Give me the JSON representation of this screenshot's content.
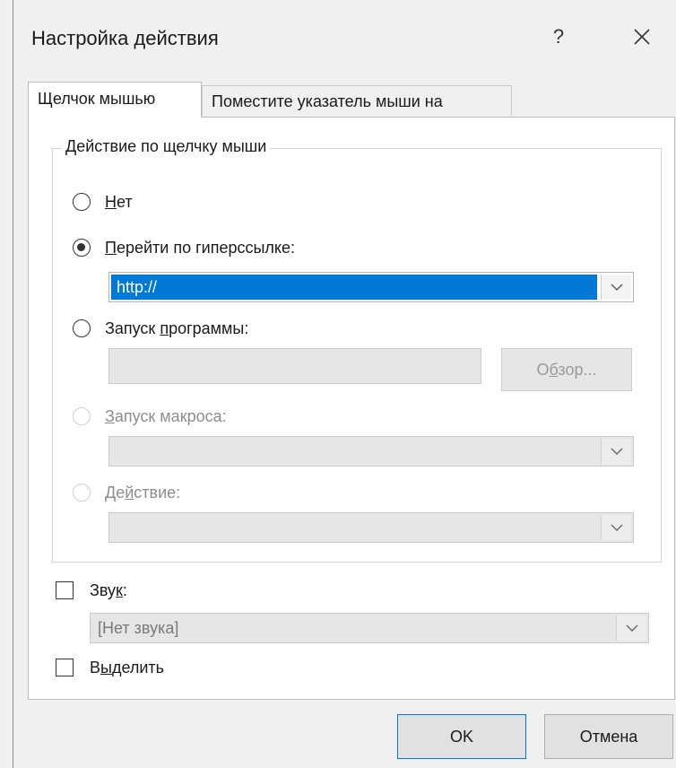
{
  "dialog": {
    "title": "Настройка действия",
    "help_label": "?"
  },
  "tabs": [
    {
      "label": "Щелчок мышью",
      "active": true
    },
    {
      "label": "Поместите указатель мыши на",
      "active": false
    }
  ],
  "group": {
    "legend": "Действие по щелчку мыши",
    "options": {
      "none": {
        "prefix": "",
        "mnemonic": "Н",
        "suffix": "ет",
        "checked": false,
        "enabled": true
      },
      "hyperlink": {
        "prefix": "",
        "mnemonic": "П",
        "suffix": "ерейти по гиперссылке:",
        "checked": true,
        "enabled": true
      },
      "run_program": {
        "prefix": "Запуск ",
        "mnemonic": "п",
        "suffix": "рограммы:",
        "checked": false,
        "enabled": true
      },
      "run_macro": {
        "prefix": "",
        "mnemonic": "З",
        "suffix": "апуск макроса:",
        "checked": false,
        "enabled": false
      },
      "action": {
        "prefix": "Де",
        "mnemonic": "й",
        "suffix": "ствие:",
        "checked": false,
        "enabled": false
      }
    },
    "hyperlink_value": "http://",
    "program_path": "",
    "browse": {
      "prefix": "О",
      "mnemonic": "б",
      "suffix": "зор..."
    },
    "macro_value": "",
    "action_value": ""
  },
  "sound": {
    "prefix": "Зву",
    "mnemonic": "к",
    "suffix": ":",
    "checked": false,
    "value": "[Нет звука]"
  },
  "highlight": {
    "prefix": "В",
    "mnemonic": "ы",
    "suffix": "делить",
    "checked": false
  },
  "buttons": {
    "ok": "OK",
    "cancel": "Отмена"
  },
  "colors": {
    "selection": "#0078d7",
    "background": "#f0f0f0"
  }
}
